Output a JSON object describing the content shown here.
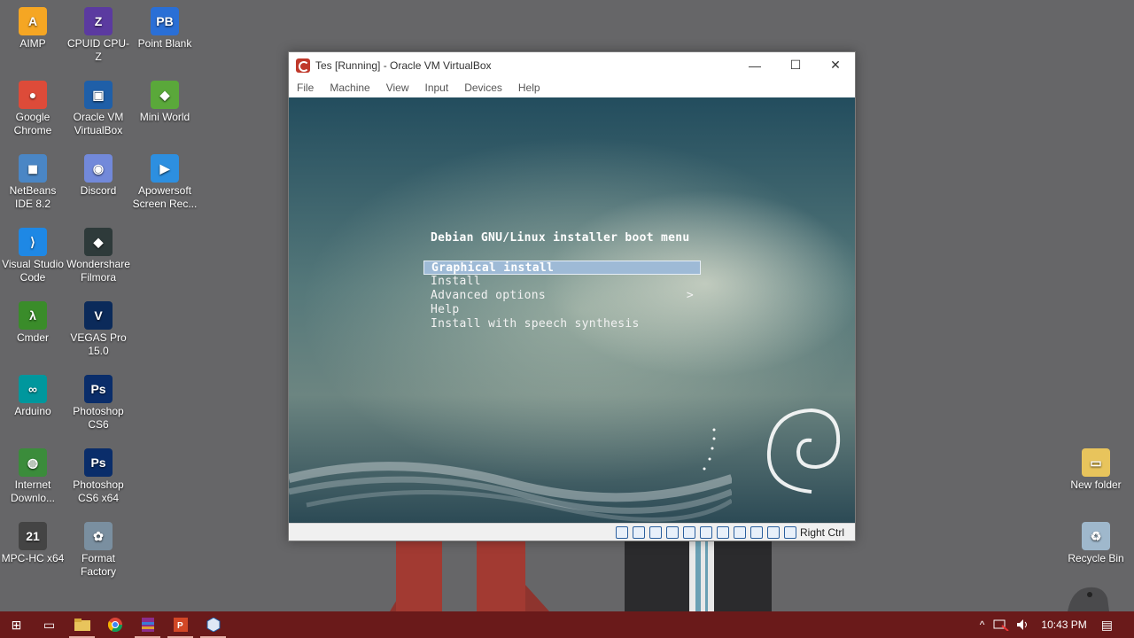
{
  "desktop": {
    "icons": [
      {
        "label": "AIMP",
        "color": "#f5a623",
        "glyph": "A"
      },
      {
        "label": "CPUID CPU-Z",
        "color": "#5b3aa0",
        "glyph": "Z"
      },
      {
        "label": "Point Blank",
        "color": "#2a6fd6",
        "glyph": "PB"
      },
      {
        "label": "Google Chrome",
        "color": "#dd4b39",
        "glyph": "●"
      },
      {
        "label": "Oracle VM VirtualBox",
        "color": "#1f5fa8",
        "glyph": "▣"
      },
      {
        "label": "Mini World",
        "color": "#5aa83a",
        "glyph": "◆"
      },
      {
        "label": "NetBeans IDE 8.2",
        "color": "#4a86c5",
        "glyph": "◼"
      },
      {
        "label": "Discord",
        "color": "#7289da",
        "glyph": "◉"
      },
      {
        "label": "Apowersoft Screen Rec...",
        "color": "#2d8fe0",
        "glyph": "▶"
      },
      {
        "label": "Visual Studio Code",
        "color": "#1e88e5",
        "glyph": "⟩"
      },
      {
        "label": "Wondershare Filmora",
        "color": "#2e3a3a",
        "glyph": "◆"
      },
      {
        "label": "Cmder",
        "color": "#3a8c2a",
        "glyph": "λ"
      },
      {
        "label": "VEGAS Pro 15.0",
        "color": "#0b2a5a",
        "glyph": "V"
      },
      {
        "label": "Arduino",
        "color": "#00979d",
        "glyph": "∞"
      },
      {
        "label": "Photoshop CS6",
        "color": "#0a2d6a",
        "glyph": "Ps"
      },
      {
        "label": "Internet Downlo...",
        "color": "#3b8c3b",
        "glyph": "◍"
      },
      {
        "label": "Photoshop CS6 x64",
        "color": "#0a2d6a",
        "glyph": "Ps"
      },
      {
        "label": "MPC-HC x64",
        "color": "#444444",
        "glyph": "21"
      },
      {
        "label": "Format Factory",
        "color": "#7a8fa0",
        "glyph": "✿"
      },
      {
        "label": "New folder",
        "color": "#e8c45c",
        "glyph": "▭"
      },
      {
        "label": "Recycle Bin",
        "color": "#9fb8cc",
        "glyph": "♻"
      }
    ]
  },
  "window": {
    "title": "Tes [Running] - Oracle VM VirtualBox",
    "menu": [
      "File",
      "Machine",
      "View",
      "Input",
      "Devices",
      "Help"
    ],
    "minimize": "—",
    "maximize": "☐",
    "close": "✕"
  },
  "vm_screen": {
    "boot_title": "Debian GNU/Linux installer boot menu",
    "items": [
      {
        "label": "Graphical install",
        "selected": true
      },
      {
        "label": "Install",
        "selected": false
      },
      {
        "label": "Advanced options",
        "selected": false,
        "submenu": ">"
      },
      {
        "label": "Help",
        "selected": false
      },
      {
        "label": "Install with speech synthesis",
        "selected": false
      }
    ]
  },
  "statusbar": {
    "host_key": "Right Ctrl"
  },
  "taskbar": {
    "start": "⊞",
    "task_view": "▭",
    "apps": [
      "file-explorer",
      "chrome",
      "winrar",
      "powerpoint",
      "virtualbox"
    ],
    "tray": {
      "chevron": "^",
      "time": "10:43 PM",
      "notification": "▤"
    }
  }
}
